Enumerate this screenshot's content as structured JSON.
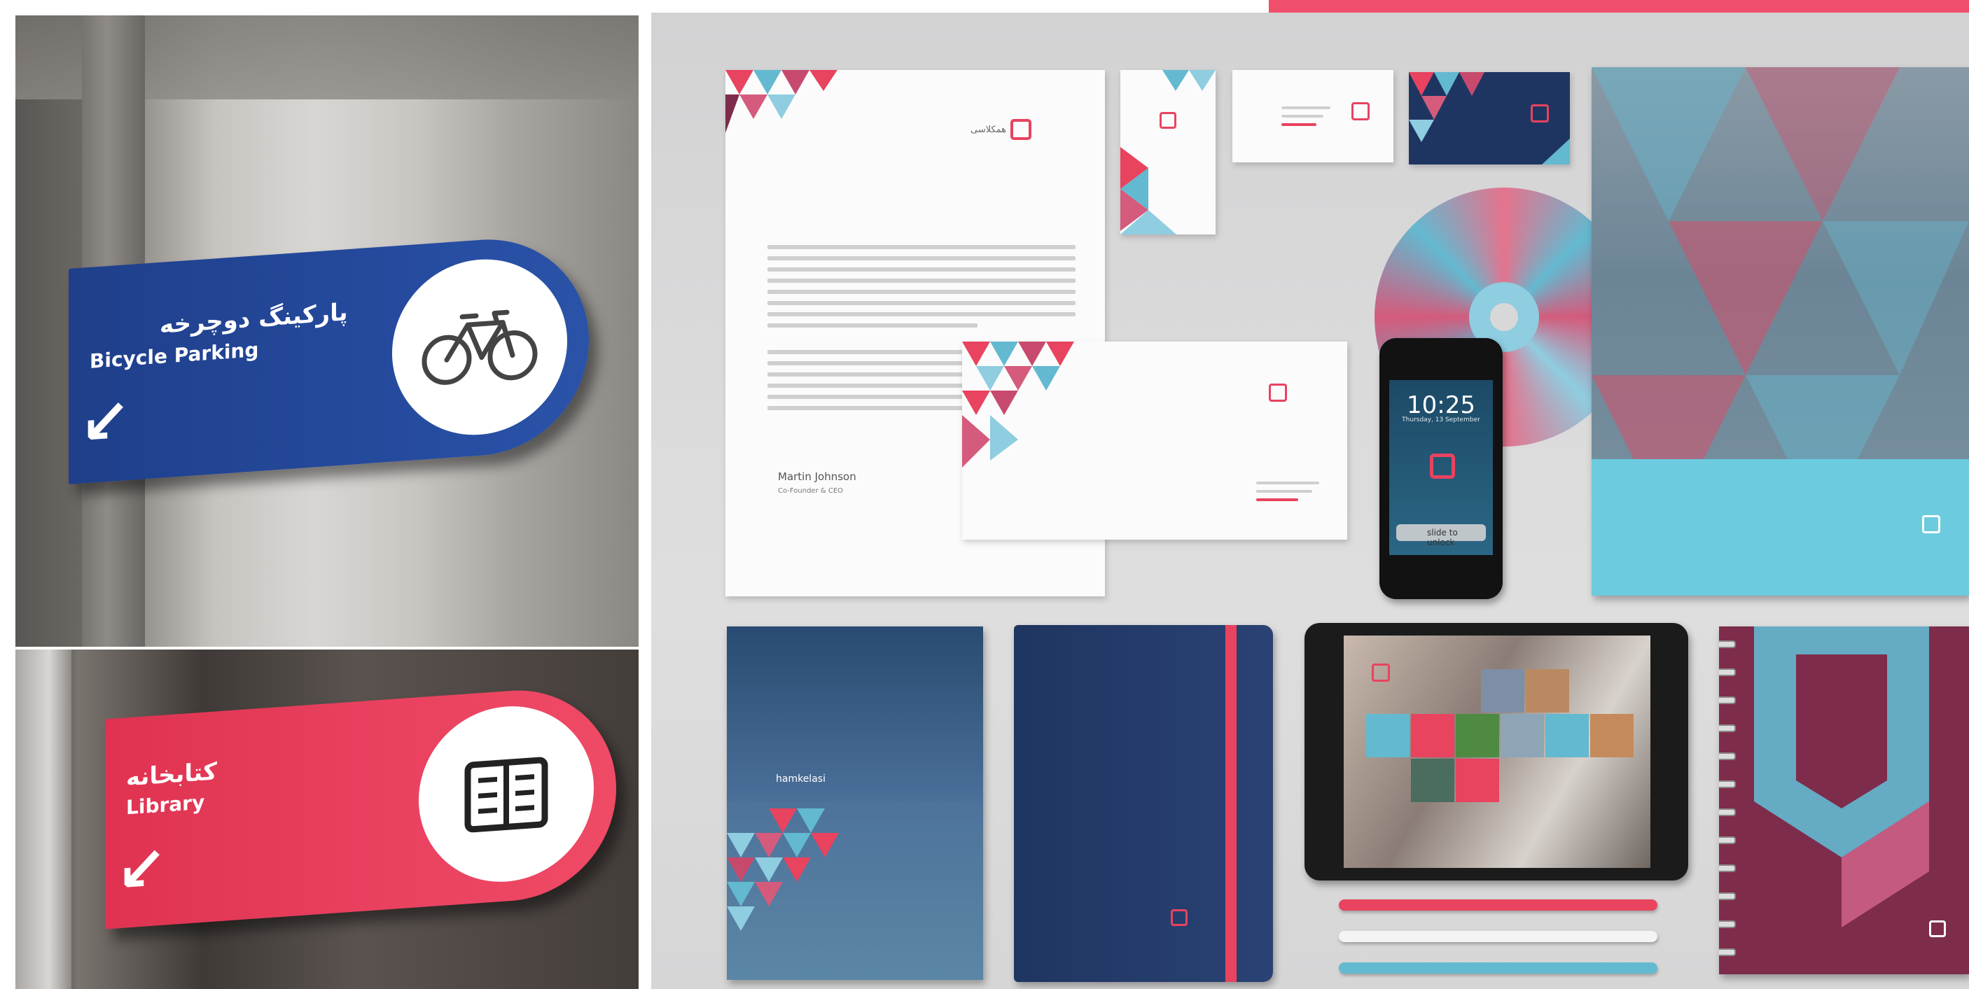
{
  "signs": {
    "bicycle": {
      "label_fa": "پارکینگ دوچرخه",
      "label_en": "Bicycle Parking",
      "arrow": "↙",
      "icon": "bicycle-icon"
    },
    "library": {
      "label_fa": "کتابخانه",
      "label_en": "Library",
      "arrow": "↙",
      "icon": "open-book-icon"
    }
  },
  "brand": {
    "name_fa": "همکلاسی",
    "name_en": "hamkelasi",
    "colors": {
      "pink": "#e8435f",
      "navy": "#1f3561",
      "sky": "#63b9d0",
      "plum": "#7e2c4b"
    }
  },
  "letterhead": {
    "signature_name": "Martin Johnson",
    "signature_title": "Co-Founder & CEO"
  },
  "phone": {
    "time": "10:25",
    "date": "Thursday, 13 September",
    "slide_text": "slide to unlock"
  }
}
